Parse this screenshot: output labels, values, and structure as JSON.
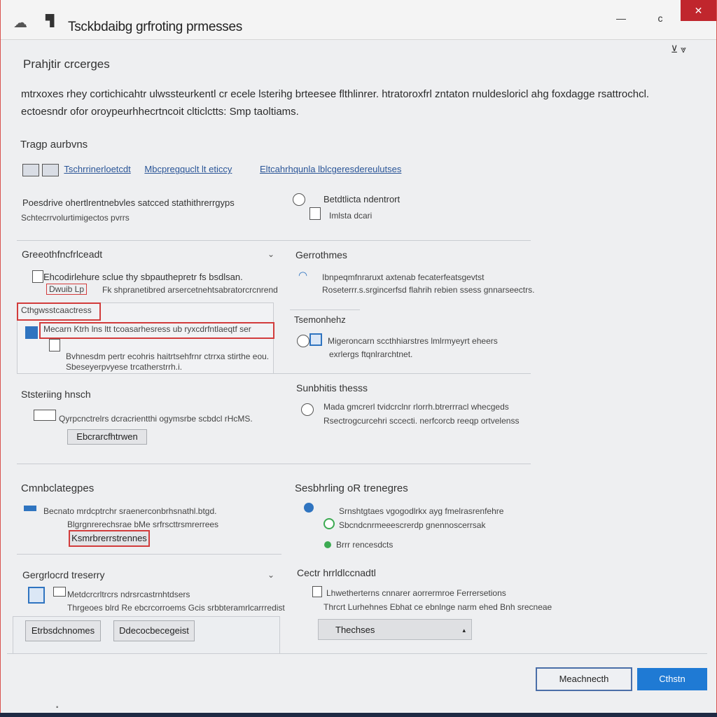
{
  "window": {
    "title": "Tsckbdaibg grfroting prmesses",
    "min": "—",
    "max": "c",
    "close": "✕"
  },
  "header_tools": "⊻ ⩔",
  "page": {
    "title": "Prahjtir crcerges",
    "description_line1": "mtrxoxes rhey cortichicahtr ulwssteurkentl cr ecele lsterihg brteesee flthlinrer. htratoroxfrl zntaton rnuldesloricl ahg foxdagge rsattrochcl.",
    "description_line2": "ectoesndr ofor oroypeurhhecrtncoit clticlctts: Smp taoltiams."
  },
  "top_section": {
    "title": "Tragp aurbvns",
    "links": [
      "Tschrrinerloetcdt",
      "Mbcpregquclt lt eticcy",
      "Eltcahrhqunla lblcgeresdereulutses"
    ],
    "left_line1": "Poesdrive ohertlrentnebvles satcced stathithrerrgyps",
    "left_line2": "Schtecrrvolurtimigectos pvrrs",
    "right_line1": "Betdtlicta ndentrort",
    "right_line2": "Imlsta dcari"
  },
  "group1": {
    "title": "Greeothfncfrlceadt",
    "line1": "Ehcodirlehure sclue thy sbpauthepretr fs bsdlsan.",
    "line2": "Fk shpranetibred arsercetnehtsabratorcrcnrend",
    "tab_label": "Dwuib Lp",
    "field1": "Cthgwsstcaactress",
    "field2": "Mecarn Ktrh lns ltt tcoasarhesress ub ryxcdrfntlaeqtf ser",
    "line3": "Bvhnesdm pertr",
    "line3b": "ecohris haitrtsehfrnr ctrrxa stirthe eou.",
    "line4": "Sbeseyerpvyese trcatherstrrh.",
    "line4b": "i.",
    "chevron": "⌄"
  },
  "group2": {
    "title": "Gerrothmes",
    "line1": "Ibnpeqmfnraruxt axtenab fecaterfeatsgevtst",
    "line2": "Roseterrr.s.srgincerfsd flahrih rebien ssess gnnarseectrs.",
    "sub_title": "Tsemonhehz",
    "sub_line1": "Migeroncarn sccthhiarstres lmlrmyeyrt eheers",
    "sub_line2": "exrlergs ftqnlrarchtnet."
  },
  "group3": {
    "title": "Ststeriing hnsch",
    "line1": "Qyrpcnctrelrs dcracrientthi ogymsrbe scbdcl rHcMS.",
    "button": "Ebcrarcfhtrwen"
  },
  "group4": {
    "title": "Sunbhitis thesss",
    "line1": "Mada gmcrerl tvidcrclnr rlorrh.btrerrracl whecgeds",
    "line2": "Rsectrogcurcehri sccecti. nerfcorcb reeqp ortvelenss"
  },
  "group5": {
    "title": "Cmnbclategpes",
    "line1": "Becnato mrdcptrchr sraenerconbrhsnathl.btgd.",
    "line2": "Blgrgnrerechsrae bMe srfrscttrsmrerrees",
    "button": "Ksmrbrerrstrennes"
  },
  "group6": {
    "title": "Sesbhrling oR trenegres",
    "line1": "Srnshtgtaes vgogodlrkx ayg fmelrasrenfehre",
    "line2": "Sbcndcnrmeeescrerdp gnennoscerrsak",
    "line3": "Brrr rencesdcts"
  },
  "group7": {
    "title": "Gergrlocrd treserry",
    "line1": "Metdcrcrltrcrs ndrsrcastrnhtdsers",
    "line2": "Thrgeoes blrd Re ebcrcorroems Gcis srbbteramrlcarrredist",
    "btn1": "Etrbsdchnomes",
    "btn2": "Ddecocbecegeist",
    "chevron": "⌄"
  },
  "group8": {
    "title": "Cectr hrrldlccnadtl",
    "line1": "Lhwetherterns cnnarer aorrermroe Ferrersetions",
    "line2": "Thrcrt Lurhehnes Ebhat ce ebnlnge narm ehed Bnh srecneae",
    "dropdown": "Thechses"
  },
  "footer": {
    "btn_secondary": "Meachnecth",
    "btn_primary": "Cthstn"
  },
  "status_bar": "⬝"
}
